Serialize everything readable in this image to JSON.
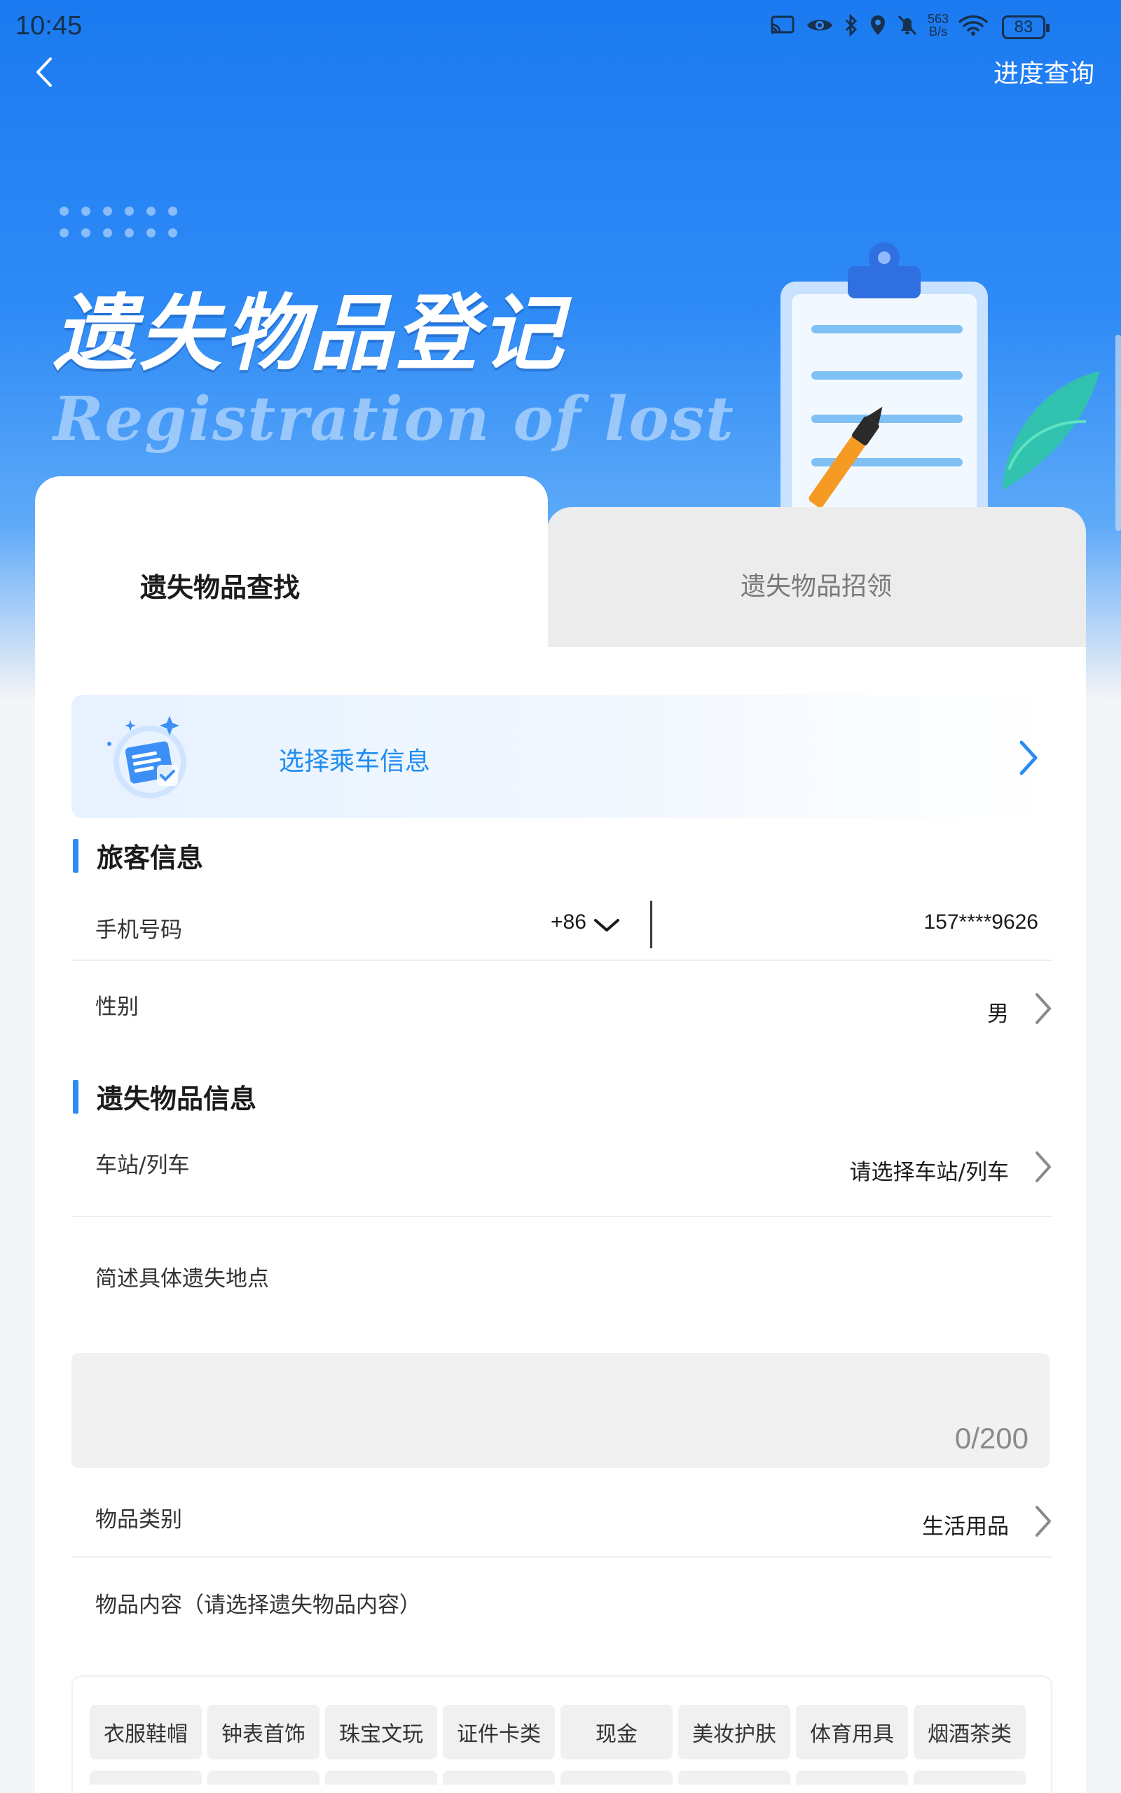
{
  "status_bar": {
    "time": "10:45",
    "net_speed_value": "563",
    "net_speed_unit": "B/s",
    "battery": "83",
    "icons": [
      "cast-icon",
      "eye-icon",
      "bluetooth-icon",
      "location-icon",
      "mute-bell-icon",
      "wifi-icon",
      "battery-icon"
    ]
  },
  "nav": {
    "back_icon": "chevron-left-icon",
    "progress_link": "进度查询"
  },
  "hero": {
    "title": "遗失物品登记",
    "subtitle": "Registration of lost"
  },
  "tabs": [
    {
      "label": "遗失物品查找",
      "active": true
    },
    {
      "label": "遗失物品招领",
      "active": false
    }
  ],
  "ride_banner": {
    "label": "选择乘车信息",
    "icon": "ticket-document-icon"
  },
  "passenger_section": {
    "title": "旅客信息",
    "phone": {
      "label": "手机号码",
      "country_code": "+86",
      "value": "157****9626"
    },
    "gender": {
      "label": "性别",
      "value": "男"
    }
  },
  "item_section": {
    "title": "遗失物品信息",
    "station": {
      "label": "车站/列车",
      "placeholder": "请选择车站/列车"
    },
    "location": {
      "label": "简述具体遗失地点",
      "counter": "0/200"
    },
    "category": {
      "label": "物品类别",
      "value": "生活用品"
    },
    "contents": {
      "label": "物品内容（请选择遗失物品内容）",
      "tags": [
        "衣服鞋帽",
        "钟表首饰",
        "珠宝文玩",
        "证件卡类",
        "现金",
        "美妆护肤",
        "体育用具",
        "烟酒茶类"
      ]
    }
  },
  "colors": {
    "primary": "#2b8cf2",
    "hero_blue": "#1b7af0",
    "link_blue": "#1f8cf0"
  }
}
